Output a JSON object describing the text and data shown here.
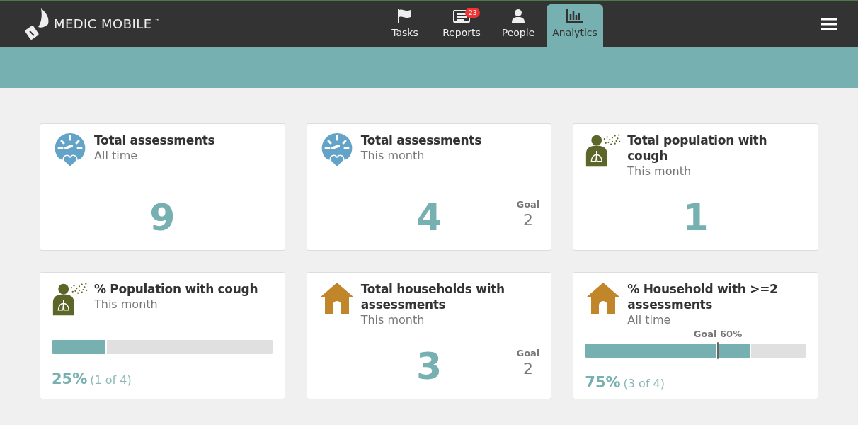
{
  "header": {
    "logo_text": "MEDIC MOBILE",
    "trademark": "™",
    "tabs": [
      {
        "label": "Tasks",
        "selected": false
      },
      {
        "label": "Reports",
        "badge": "23",
        "selected": false
      },
      {
        "label": "People",
        "selected": false
      },
      {
        "label": "Analytics",
        "selected": true
      }
    ]
  },
  "cards": [
    {
      "kind": "count",
      "title": "Total assessments",
      "subtitle": "All time",
      "value": "9"
    },
    {
      "kind": "count",
      "title": "Total assessments",
      "subtitle": "This month",
      "value": "4",
      "goal": {
        "label": "Goal",
        "value": "2"
      }
    },
    {
      "kind": "count",
      "title": "Total population with cough",
      "subtitle": "This month",
      "value": "1"
    },
    {
      "kind": "percent",
      "title": "% Population with cough",
      "subtitle": "This month",
      "level": 0.25,
      "value": "25%",
      "detail": "(1 of 4)"
    },
    {
      "kind": "count",
      "title": "Total households with assessments",
      "subtitle": "This month",
      "value": "3",
      "goal": {
        "label": "Goal",
        "value": "2"
      }
    },
    {
      "kind": "percent",
      "title": "% Household with >=2 assessments",
      "subtitle": "All time",
      "level": 0.75,
      "value": "75%",
      "detail": "(3 of 4)",
      "goal": {
        "label": "Goal 60%",
        "level": 0.6
      }
    }
  ]
}
